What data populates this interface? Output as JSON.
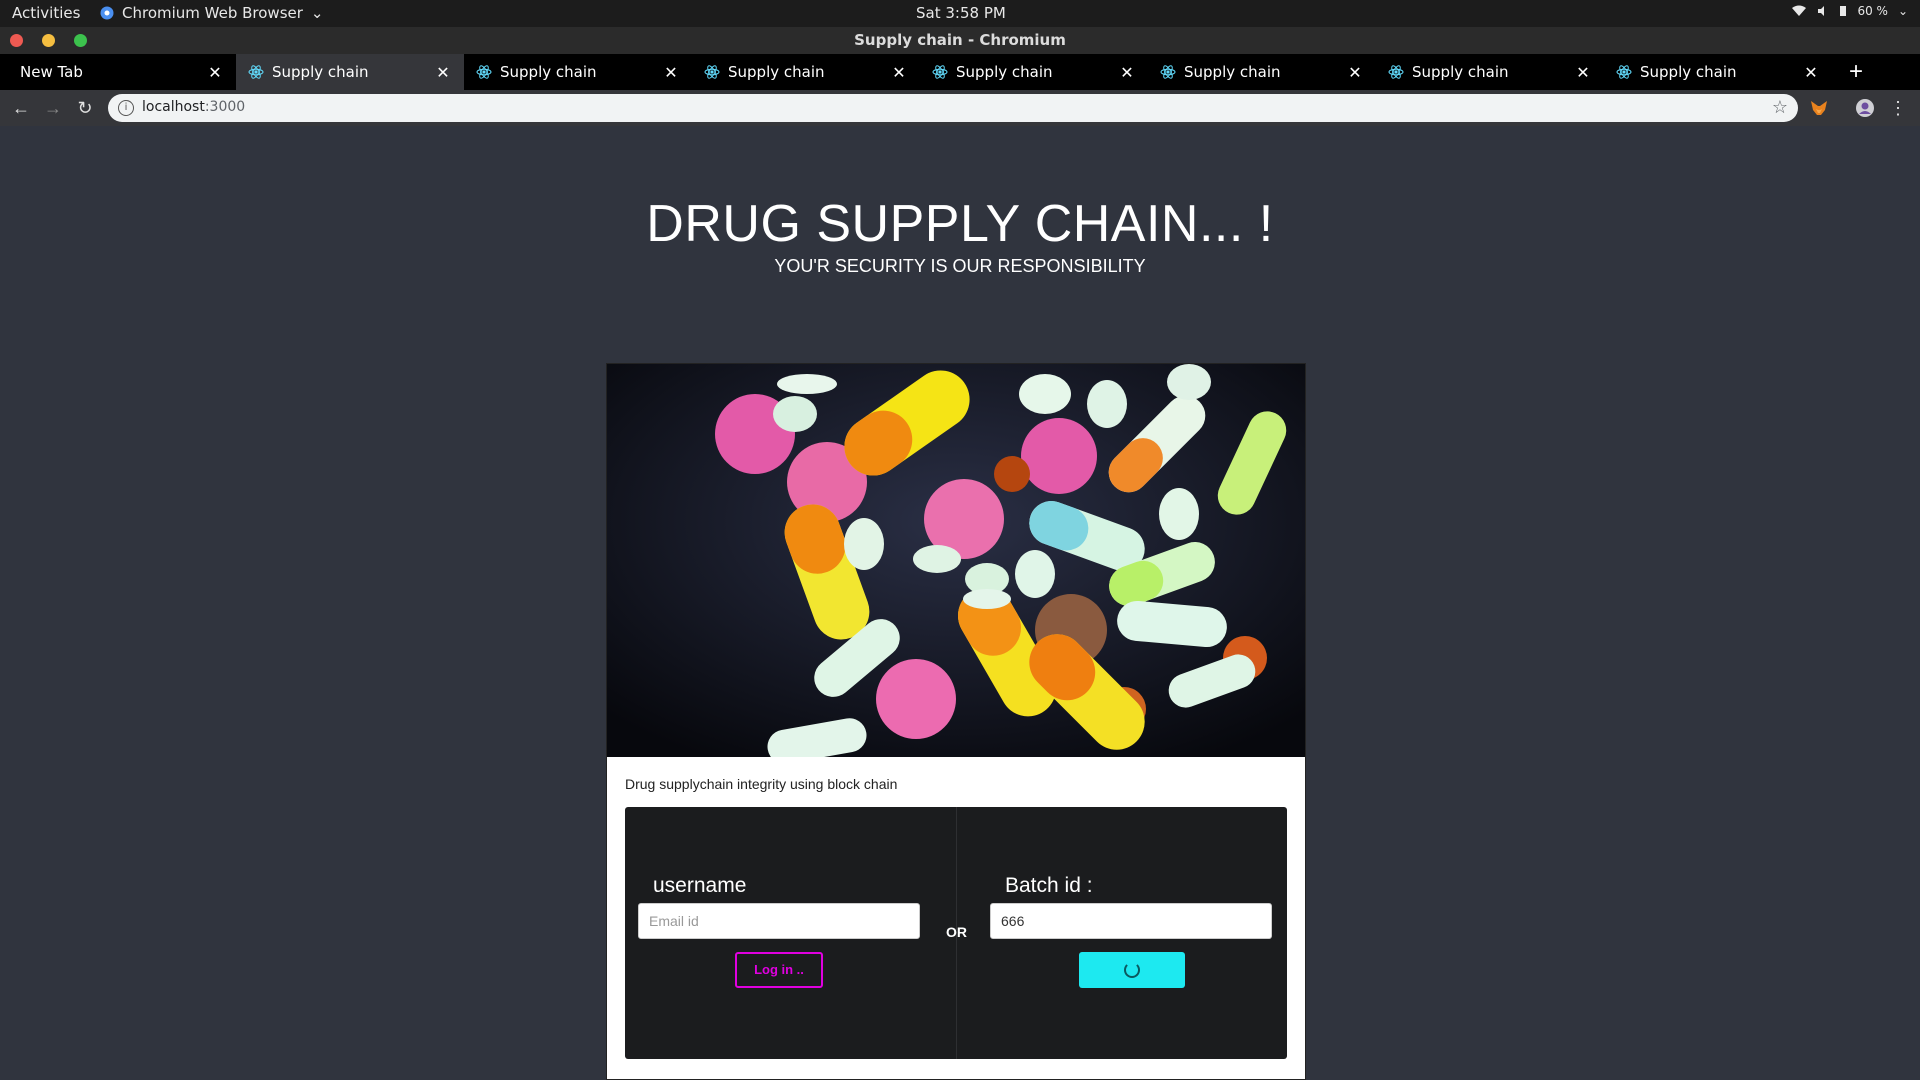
{
  "system_bar": {
    "activities": "Activities",
    "app_name": "Chromium Web Browser",
    "clock": "Sat  3:58 PM",
    "battery": "60 %"
  },
  "window": {
    "title": "Supply chain - Chromium"
  },
  "tabs": [
    {
      "title": "New Tab",
      "active": false,
      "favicon": false
    },
    {
      "title": "Supply chain",
      "active": true,
      "favicon": true
    },
    {
      "title": "Supply chain",
      "active": false,
      "favicon": true
    },
    {
      "title": "Supply chain",
      "active": false,
      "favicon": true
    },
    {
      "title": "Supply chain",
      "active": false,
      "favicon": true
    },
    {
      "title": "Supply chain",
      "active": false,
      "favicon": true
    },
    {
      "title": "Supply chain",
      "active": false,
      "favicon": true
    },
    {
      "title": "Supply chain",
      "active": false,
      "favicon": true
    }
  ],
  "address_bar": {
    "host": "localhost",
    "port": ":3000"
  },
  "page": {
    "title": "DRUG SUPPLY CHAIN... !",
    "subtitle": "YOU'R SECURITY IS OUR RESPONSIBILITY",
    "card_text": "Drug supplychain integrity using block chain",
    "login": {
      "username_label": "username",
      "email_placeholder": "Email id",
      "login_button": "Log in .."
    },
    "or_text": "OR",
    "batch": {
      "label": "Batch id :",
      "value": "666"
    }
  },
  "colors": {
    "page_bg": "#30343e",
    "login_accent": "#e000e0",
    "search_button": "#1de9f0"
  }
}
